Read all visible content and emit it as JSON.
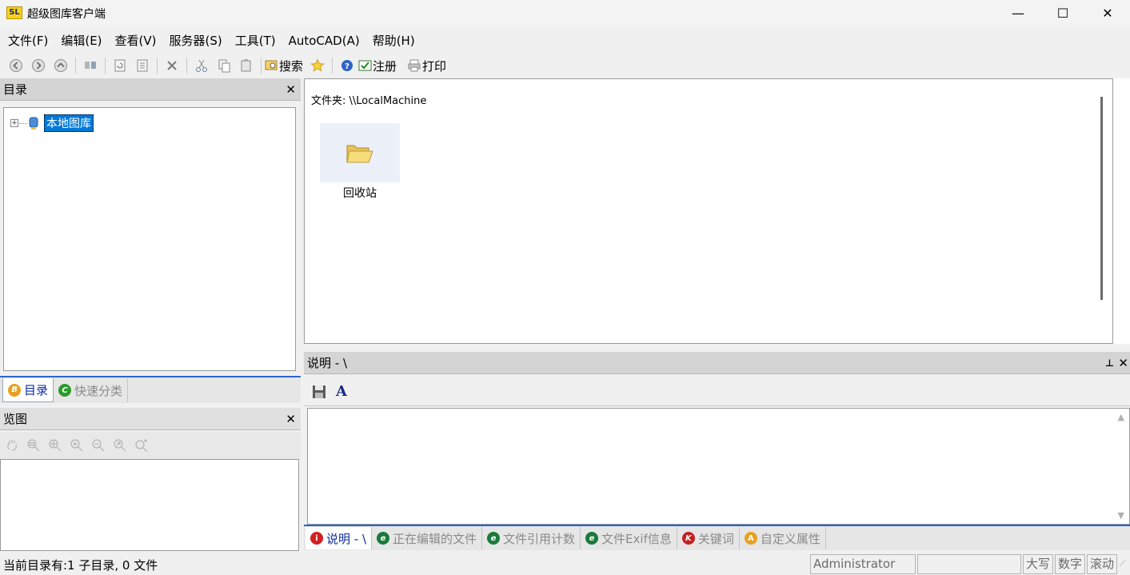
{
  "window": {
    "logo_text": "SL",
    "title": "超级图库客户端",
    "minimize_glyph": "—",
    "maximize_glyph": "☐",
    "close_glyph": "✕"
  },
  "menu": [
    "文件(F)",
    "编辑(E)",
    "查看(V)",
    "服务器(S)",
    "工具(T)",
    "AutoCAD(A)",
    "帮助(H)"
  ],
  "toolbar": {
    "search_label": "搜索",
    "register_label": "注册",
    "print_label": "打印"
  },
  "directory_panel": {
    "title": "目录",
    "close_glyph": "✕",
    "tree_expander": "+",
    "tree_root": "本地图库"
  },
  "left_tabs": {
    "catalog": "目录",
    "quick_category": "快速分类"
  },
  "overview_panel": {
    "title": "览图",
    "close_glyph": "✕"
  },
  "file_area": {
    "folder_path": "文件夹: \\\\LocalMachine",
    "items": [
      {
        "name": "回收站"
      }
    ]
  },
  "description_panel": {
    "title": "说明 - \\",
    "pin_glyph": "⊥",
    "close_glyph": "✕",
    "font_button": "A"
  },
  "bottom_tabs": {
    "description": "说明 - \\",
    "editing_files": "正在编辑的文件",
    "file_reference_count": "文件引用计数",
    "exif_info": "文件Exif信息",
    "keywords": "关键词",
    "custom_attributes": "自定义属性"
  },
  "statusbar": {
    "message": "当前目录有:1 子目录, 0 文件",
    "user": "Administrator",
    "caps": "大写",
    "num": "数字",
    "scroll": "滚动"
  },
  "colors": {
    "selection": "#0078d7",
    "accent_border": "#2a66cc",
    "active_tab_text": "#0a2ca0"
  }
}
